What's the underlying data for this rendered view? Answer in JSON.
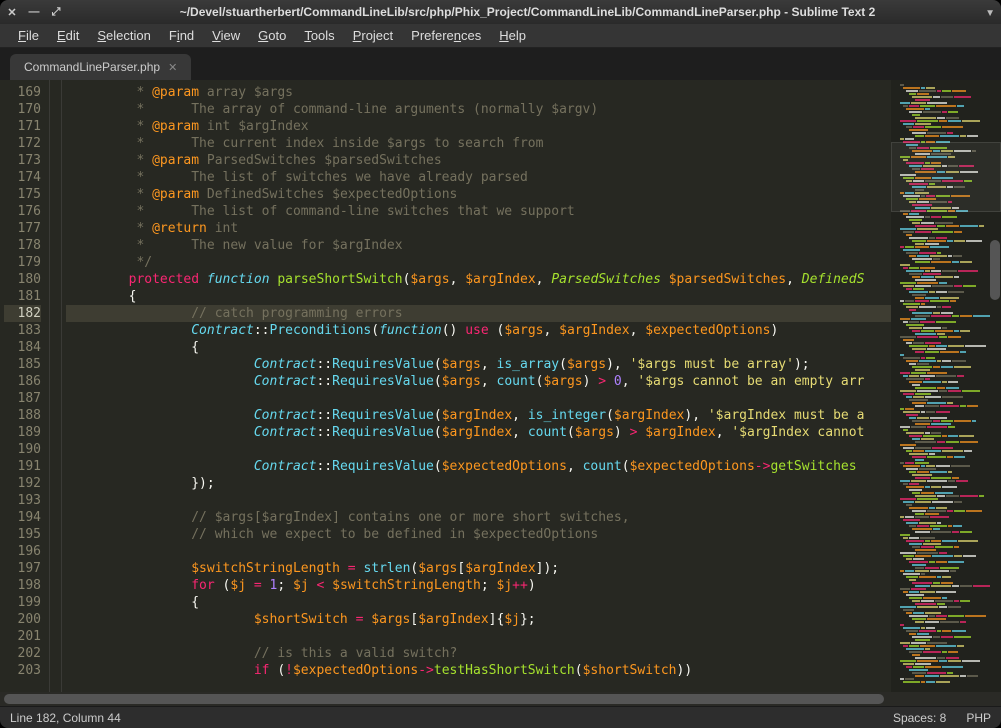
{
  "titlebar": {
    "title": "~/Devel/stuartherbert/CommandLineLib/src/php/Phix_Project/CommandLineLib/CommandLineParser.php - Sublime Text 2"
  },
  "menubar": {
    "items": [
      {
        "label": "File",
        "u": "F"
      },
      {
        "label": "Edit",
        "u": "E"
      },
      {
        "label": "Selection",
        "u": "S"
      },
      {
        "label": "Find",
        "u": "i"
      },
      {
        "label": "View",
        "u": "V"
      },
      {
        "label": "Goto",
        "u": "G"
      },
      {
        "label": "Tools",
        "u": "T"
      },
      {
        "label": "Project",
        "u": "P"
      },
      {
        "label": "Preferences",
        "u": "n"
      },
      {
        "label": "Help",
        "u": "H"
      }
    ]
  },
  "tabs": [
    {
      "name": "CommandLineParser.php"
    }
  ],
  "gutter": {
    "start": 169,
    "end": 203,
    "current": 182
  },
  "code_lines": [
    {
      "n": 169,
      "segs": [
        {
          "t": "         * ",
          "c": "c-comment"
        },
        {
          "t": "@param",
          "c": "c-tag"
        },
        {
          "t": " array $args",
          "c": "c-comment"
        }
      ]
    },
    {
      "n": 170,
      "segs": [
        {
          "t": "         *      The array of command-line arguments (normally $argv)",
          "c": "c-comment"
        }
      ]
    },
    {
      "n": 171,
      "segs": [
        {
          "t": "         * ",
          "c": "c-comment"
        },
        {
          "t": "@param",
          "c": "c-tag"
        },
        {
          "t": " int $argIndex",
          "c": "c-comment"
        }
      ]
    },
    {
      "n": 172,
      "segs": [
        {
          "t": "         *      The current index inside $args to search from",
          "c": "c-comment"
        }
      ]
    },
    {
      "n": 173,
      "segs": [
        {
          "t": "         * ",
          "c": "c-comment"
        },
        {
          "t": "@param",
          "c": "c-tag"
        },
        {
          "t": " ParsedSwitches $parsedSwitches",
          "c": "c-comment"
        }
      ]
    },
    {
      "n": 174,
      "segs": [
        {
          "t": "         *      The list of switches we have already parsed",
          "c": "c-comment"
        }
      ]
    },
    {
      "n": 175,
      "segs": [
        {
          "t": "         * ",
          "c": "c-comment"
        },
        {
          "t": "@param",
          "c": "c-tag"
        },
        {
          "t": " DefinedSwitches $expectedOptions",
          "c": "c-comment"
        }
      ]
    },
    {
      "n": 176,
      "segs": [
        {
          "t": "         *      The list of command-line switches that we support",
          "c": "c-comment"
        }
      ]
    },
    {
      "n": 177,
      "segs": [
        {
          "t": "         * ",
          "c": "c-comment"
        },
        {
          "t": "@return",
          "c": "c-tag"
        },
        {
          "t": " int",
          "c": "c-comment"
        }
      ]
    },
    {
      "n": 178,
      "segs": [
        {
          "t": "         *      The new value for $argIndex",
          "c": "c-comment"
        }
      ]
    },
    {
      "n": 179,
      "segs": [
        {
          "t": "         */",
          "c": "c-comment"
        }
      ]
    },
    {
      "n": 180,
      "segs": [
        {
          "t": "        ",
          "c": ""
        },
        {
          "t": "protected",
          "c": "c-keyword"
        },
        {
          "t": " ",
          "c": ""
        },
        {
          "t": "function",
          "c": "c-class"
        },
        {
          "t": " ",
          "c": ""
        },
        {
          "t": "parseShortSwitch",
          "c": "c-func"
        },
        {
          "t": "(",
          "c": ""
        },
        {
          "t": "$args",
          "c": "c-var"
        },
        {
          "t": ", ",
          "c": ""
        },
        {
          "t": "$argIndex",
          "c": "c-var"
        },
        {
          "t": ", ",
          "c": ""
        },
        {
          "t": "ParsedSwitches",
          "c": "c-type"
        },
        {
          "t": " ",
          "c": ""
        },
        {
          "t": "$parsedSwitches",
          "c": "c-var"
        },
        {
          "t": ", ",
          "c": ""
        },
        {
          "t": "DefinedS",
          "c": "c-type"
        }
      ]
    },
    {
      "n": 181,
      "segs": [
        {
          "t": "        {",
          "c": ""
        }
      ]
    },
    {
      "n": 182,
      "cur": true,
      "segs": [
        {
          "t": "                ",
          "c": ""
        },
        {
          "t": "// catch programming errors",
          "c": "c-comment"
        }
      ]
    },
    {
      "n": 183,
      "segs": [
        {
          "t": "                ",
          "c": ""
        },
        {
          "t": "Contract",
          "c": "c-class"
        },
        {
          "t": "::",
          "c": ""
        },
        {
          "t": "Preconditions",
          "c": "c-method"
        },
        {
          "t": "(",
          "c": ""
        },
        {
          "t": "function",
          "c": "c-class"
        },
        {
          "t": "() ",
          "c": ""
        },
        {
          "t": "use",
          "c": "c-keyword"
        },
        {
          "t": " (",
          "c": ""
        },
        {
          "t": "$args",
          "c": "c-var"
        },
        {
          "t": ", ",
          "c": ""
        },
        {
          "t": "$argIndex",
          "c": "c-var"
        },
        {
          "t": ", ",
          "c": ""
        },
        {
          "t": "$expectedOptions",
          "c": "c-var"
        },
        {
          "t": ")",
          "c": ""
        }
      ]
    },
    {
      "n": 184,
      "segs": [
        {
          "t": "                {",
          "c": ""
        }
      ]
    },
    {
      "n": 185,
      "segs": [
        {
          "t": "                        ",
          "c": ""
        },
        {
          "t": "Contract",
          "c": "c-class"
        },
        {
          "t": "::",
          "c": ""
        },
        {
          "t": "RequiresValue",
          "c": "c-method"
        },
        {
          "t": "(",
          "c": ""
        },
        {
          "t": "$args",
          "c": "c-var"
        },
        {
          "t": ", ",
          "c": ""
        },
        {
          "t": "is_array",
          "c": "c-method"
        },
        {
          "t": "(",
          "c": ""
        },
        {
          "t": "$args",
          "c": "c-var"
        },
        {
          "t": "), ",
          "c": ""
        },
        {
          "t": "'$args must be array'",
          "c": "c-string"
        },
        {
          "t": ");",
          "c": ""
        }
      ]
    },
    {
      "n": 186,
      "segs": [
        {
          "t": "                        ",
          "c": ""
        },
        {
          "t": "Contract",
          "c": "c-class"
        },
        {
          "t": "::",
          "c": ""
        },
        {
          "t": "RequiresValue",
          "c": "c-method"
        },
        {
          "t": "(",
          "c": ""
        },
        {
          "t": "$args",
          "c": "c-var"
        },
        {
          "t": ", ",
          "c": ""
        },
        {
          "t": "count",
          "c": "c-method"
        },
        {
          "t": "(",
          "c": ""
        },
        {
          "t": "$args",
          "c": "c-var"
        },
        {
          "t": ") ",
          "c": ""
        },
        {
          "t": ">",
          "c": "c-keyword"
        },
        {
          "t": " ",
          "c": ""
        },
        {
          "t": "0",
          "c": "c-num"
        },
        {
          "t": ", ",
          "c": ""
        },
        {
          "t": "'$args cannot be an empty arr",
          "c": "c-string"
        }
      ]
    },
    {
      "n": 187,
      "segs": [
        {
          "t": "",
          "c": ""
        }
      ]
    },
    {
      "n": 188,
      "segs": [
        {
          "t": "                        ",
          "c": ""
        },
        {
          "t": "Contract",
          "c": "c-class"
        },
        {
          "t": "::",
          "c": ""
        },
        {
          "t": "RequiresValue",
          "c": "c-method"
        },
        {
          "t": "(",
          "c": ""
        },
        {
          "t": "$argIndex",
          "c": "c-var"
        },
        {
          "t": ", ",
          "c": ""
        },
        {
          "t": "is_integer",
          "c": "c-method"
        },
        {
          "t": "(",
          "c": ""
        },
        {
          "t": "$argIndex",
          "c": "c-var"
        },
        {
          "t": "), ",
          "c": ""
        },
        {
          "t": "'$argIndex must be a",
          "c": "c-string"
        }
      ]
    },
    {
      "n": 189,
      "segs": [
        {
          "t": "                        ",
          "c": ""
        },
        {
          "t": "Contract",
          "c": "c-class"
        },
        {
          "t": "::",
          "c": ""
        },
        {
          "t": "RequiresValue",
          "c": "c-method"
        },
        {
          "t": "(",
          "c": ""
        },
        {
          "t": "$argIndex",
          "c": "c-var"
        },
        {
          "t": ", ",
          "c": ""
        },
        {
          "t": "count",
          "c": "c-method"
        },
        {
          "t": "(",
          "c": ""
        },
        {
          "t": "$args",
          "c": "c-var"
        },
        {
          "t": ") ",
          "c": ""
        },
        {
          "t": ">",
          "c": "c-keyword"
        },
        {
          "t": " ",
          "c": ""
        },
        {
          "t": "$argIndex",
          "c": "c-var"
        },
        {
          "t": ", ",
          "c": ""
        },
        {
          "t": "'$argIndex cannot",
          "c": "c-string"
        }
      ]
    },
    {
      "n": 190,
      "segs": [
        {
          "t": "",
          "c": ""
        }
      ]
    },
    {
      "n": 191,
      "segs": [
        {
          "t": "                        ",
          "c": ""
        },
        {
          "t": "Contract",
          "c": "c-class"
        },
        {
          "t": "::",
          "c": ""
        },
        {
          "t": "RequiresValue",
          "c": "c-method"
        },
        {
          "t": "(",
          "c": ""
        },
        {
          "t": "$expectedOptions",
          "c": "c-var"
        },
        {
          "t": ", ",
          "c": ""
        },
        {
          "t": "count",
          "c": "c-method"
        },
        {
          "t": "(",
          "c": ""
        },
        {
          "t": "$expectedOptions",
          "c": "c-var"
        },
        {
          "t": "->",
          "c": "c-keyword"
        },
        {
          "t": "getSwitches",
          "c": "c-func"
        }
      ]
    },
    {
      "n": 192,
      "segs": [
        {
          "t": "                });",
          "c": ""
        }
      ]
    },
    {
      "n": 193,
      "segs": [
        {
          "t": "",
          "c": ""
        }
      ]
    },
    {
      "n": 194,
      "segs": [
        {
          "t": "                ",
          "c": ""
        },
        {
          "t": "// $args[$argIndex] contains one or more short switches,",
          "c": "c-comment"
        }
      ]
    },
    {
      "n": 195,
      "segs": [
        {
          "t": "                ",
          "c": ""
        },
        {
          "t": "// which we expect to be defined in $expectedOptions",
          "c": "c-comment"
        }
      ]
    },
    {
      "n": 196,
      "segs": [
        {
          "t": "",
          "c": ""
        }
      ]
    },
    {
      "n": 197,
      "segs": [
        {
          "t": "                ",
          "c": ""
        },
        {
          "t": "$switchStringLength",
          "c": "c-var"
        },
        {
          "t": " ",
          "c": ""
        },
        {
          "t": "=",
          "c": "c-keyword"
        },
        {
          "t": " ",
          "c": ""
        },
        {
          "t": "strlen",
          "c": "c-method"
        },
        {
          "t": "(",
          "c": ""
        },
        {
          "t": "$args",
          "c": "c-var"
        },
        {
          "t": "[",
          "c": ""
        },
        {
          "t": "$argIndex",
          "c": "c-var"
        },
        {
          "t": "]);",
          "c": ""
        }
      ]
    },
    {
      "n": 198,
      "segs": [
        {
          "t": "                ",
          "c": ""
        },
        {
          "t": "for",
          "c": "c-keyword"
        },
        {
          "t": " (",
          "c": ""
        },
        {
          "t": "$j",
          "c": "c-var"
        },
        {
          "t": " ",
          "c": ""
        },
        {
          "t": "=",
          "c": "c-keyword"
        },
        {
          "t": " ",
          "c": ""
        },
        {
          "t": "1",
          "c": "c-num"
        },
        {
          "t": "; ",
          "c": ""
        },
        {
          "t": "$j",
          "c": "c-var"
        },
        {
          "t": " ",
          "c": ""
        },
        {
          "t": "<",
          "c": "c-keyword"
        },
        {
          "t": " ",
          "c": ""
        },
        {
          "t": "$switchStringLength",
          "c": "c-var"
        },
        {
          "t": "; ",
          "c": ""
        },
        {
          "t": "$j",
          "c": "c-var"
        },
        {
          "t": "++",
          "c": "c-keyword"
        },
        {
          "t": ")",
          "c": ""
        }
      ]
    },
    {
      "n": 199,
      "segs": [
        {
          "t": "                {",
          "c": ""
        }
      ]
    },
    {
      "n": 200,
      "segs": [
        {
          "t": "                        ",
          "c": ""
        },
        {
          "t": "$shortSwitch",
          "c": "c-var"
        },
        {
          "t": " ",
          "c": ""
        },
        {
          "t": "=",
          "c": "c-keyword"
        },
        {
          "t": " ",
          "c": ""
        },
        {
          "t": "$args",
          "c": "c-var"
        },
        {
          "t": "[",
          "c": ""
        },
        {
          "t": "$argIndex",
          "c": "c-var"
        },
        {
          "t": "]{",
          "c": ""
        },
        {
          "t": "$j",
          "c": "c-var"
        },
        {
          "t": "};",
          "c": ""
        }
      ]
    },
    {
      "n": 201,
      "segs": [
        {
          "t": "",
          "c": ""
        }
      ]
    },
    {
      "n": 202,
      "segs": [
        {
          "t": "                        ",
          "c": ""
        },
        {
          "t": "// is this a valid switch?",
          "c": "c-comment"
        }
      ]
    },
    {
      "n": 203,
      "segs": [
        {
          "t": "                        ",
          "c": ""
        },
        {
          "t": "if",
          "c": "c-keyword"
        },
        {
          "t": " (",
          "c": ""
        },
        {
          "t": "!",
          "c": "c-keyword"
        },
        {
          "t": "$expectedOptions",
          "c": "c-var"
        },
        {
          "t": "->",
          "c": "c-keyword"
        },
        {
          "t": "testHasShortSwitch",
          "c": "c-func"
        },
        {
          "t": "(",
          "c": ""
        },
        {
          "t": "$shortSwitch",
          "c": "c-var"
        },
        {
          "t": "))",
          "c": ""
        }
      ]
    }
  ],
  "status": {
    "left": "Line 182, Column 44",
    "spaces": "Spaces: 8",
    "lang": "PHP"
  }
}
